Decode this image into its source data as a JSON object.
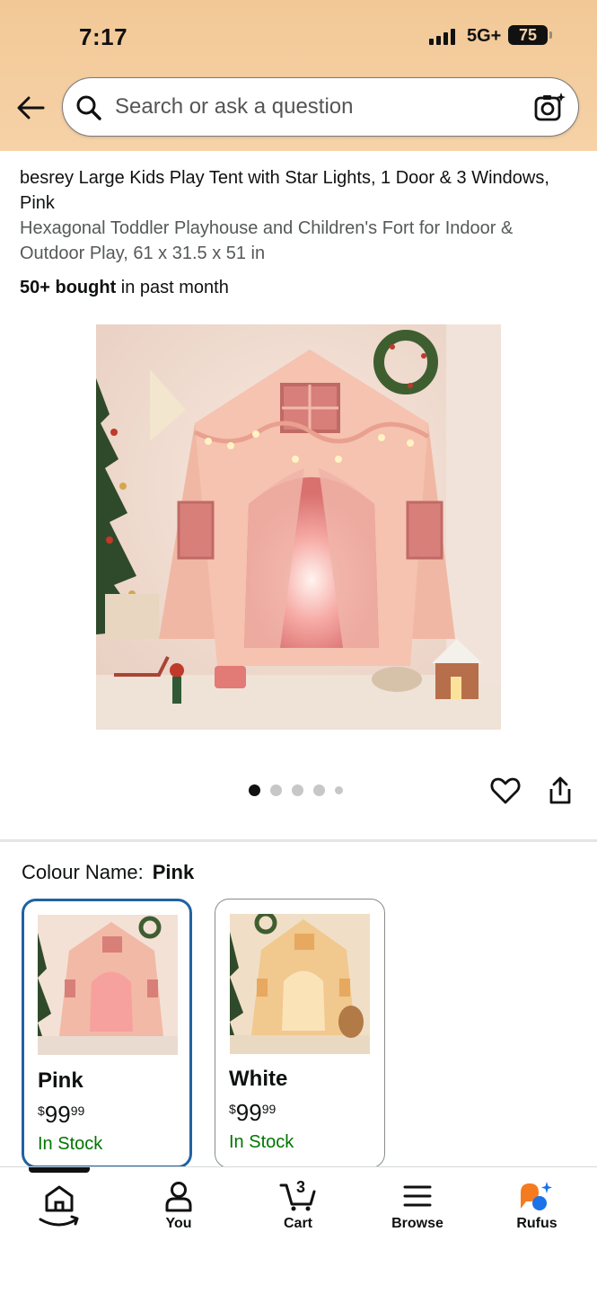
{
  "status_bar": {
    "time": "7:17",
    "network": "5G+",
    "battery": "75"
  },
  "search": {
    "placeholder": "Search or ask a question"
  },
  "product": {
    "title": "besrey Large Kids Play Tent with Star Lights, 1 Door & 3 Windows, Pink",
    "subtitle": "Hexagonal Toddler Playhouse and Children's Fort for Indoor & Outdoor Play, 61 x 31.5 x 51 in",
    "bought_bold": "50+ bought",
    "bought_rest": " in past month",
    "image_count": 5,
    "active_image": 1
  },
  "colour": {
    "label": "Colour Name:",
    "selected": "Pink",
    "options": [
      {
        "name": "Pink",
        "currency": "$",
        "whole": "99",
        "fraction": "99",
        "stock": "In Stock"
      },
      {
        "name": "White",
        "currency": "$",
        "whole": "99",
        "fraction": "99",
        "stock": "In Stock"
      }
    ]
  },
  "tabbar": {
    "home": "",
    "you": "You",
    "cart": "Cart",
    "cart_count": "3",
    "browse": "Browse",
    "rufus": "Rufus"
  },
  "colors": {
    "selected_border": "#2162a1",
    "in_stock": "#007600",
    "header_bg": "#f4cda0",
    "rufus_orange": "#f47b20",
    "rufus_blue": "#1a73e8"
  }
}
